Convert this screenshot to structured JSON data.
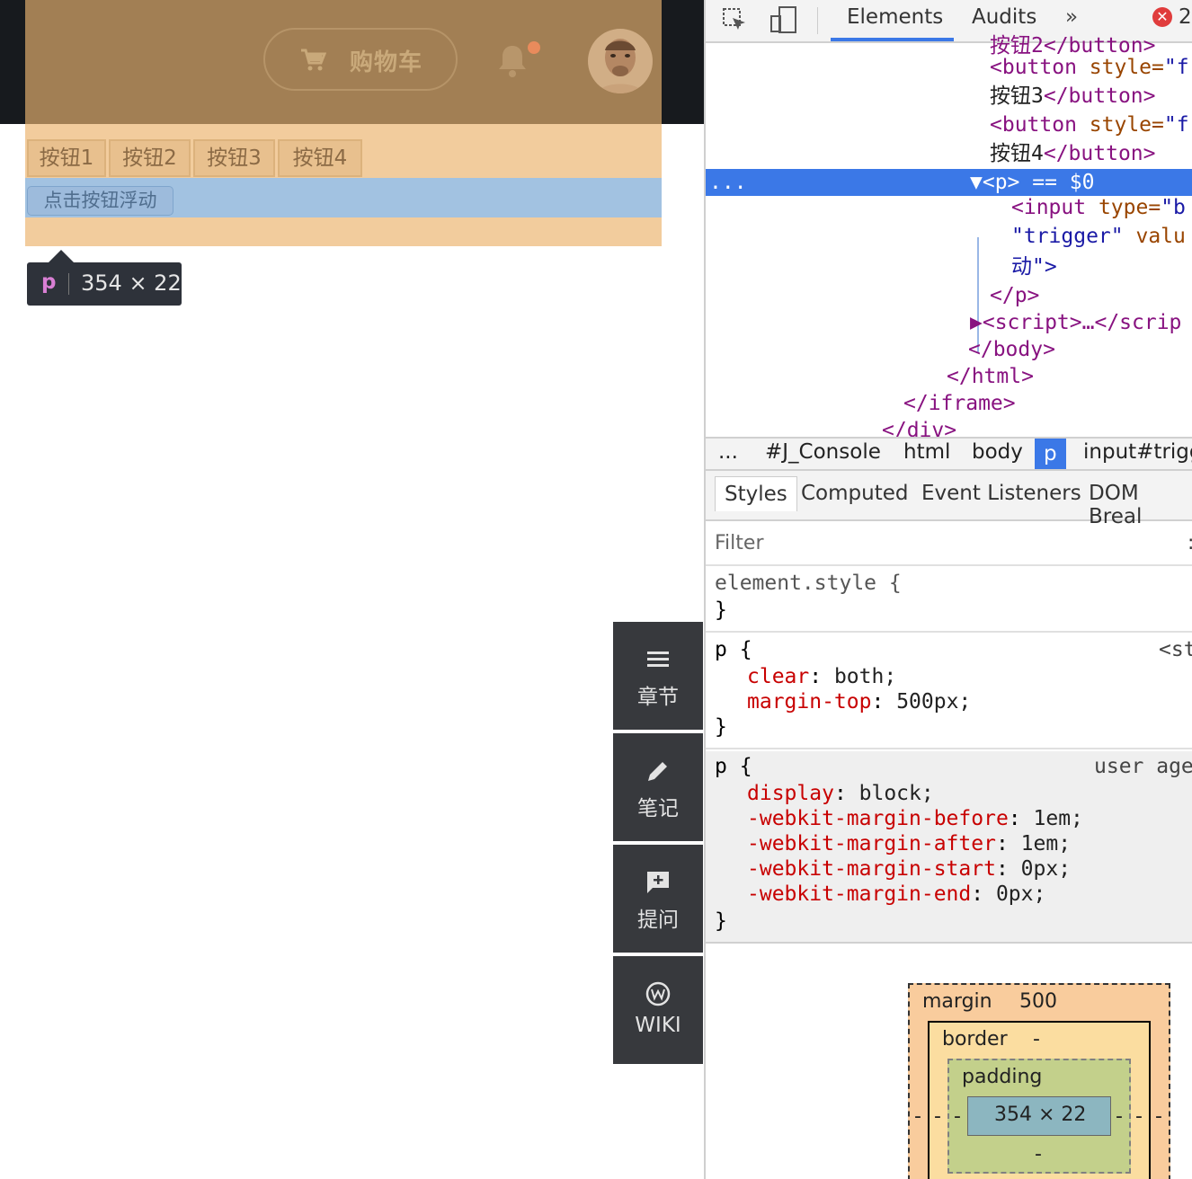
{
  "header": {
    "cart_label": "购物车",
    "cart_icon": "cart-icon",
    "bell_icon": "bell-icon",
    "colors": {
      "topbar": "#171a1e",
      "header_highlight": "#a27f54",
      "body_highlight": "#f2cc9d",
      "p_highlight": "#a2c2e1"
    }
  },
  "buttons": [
    "按钮1",
    "按钮2",
    "按钮3",
    "按钮4"
  ],
  "float_button_label": "点击按钮浮动",
  "tooltip": {
    "tag": "p",
    "dims": "354 × 22"
  },
  "sidebar": {
    "items": [
      {
        "label": "章节",
        "icon": "menu-icon"
      },
      {
        "label": "笔记",
        "icon": "pencil-icon"
      },
      {
        "label": "提问",
        "icon": "question-icon"
      },
      {
        "label": "WIKI",
        "icon": "wiki-icon"
      }
    ]
  },
  "devtools": {
    "tabs": {
      "elements": "Elements",
      "audits": "Audits",
      "more": "»"
    },
    "error_count": "2",
    "dom_lines": {
      "l0": "按钮2</button>",
      "l1a": "<button",
      "l1b": " style=",
      "l1c": "\"f",
      "l2a": "按钮3",
      "l2b": "</button>",
      "l3a": "<button",
      "l3b": " style=",
      "l3c": "\"f",
      "l4a": "按钮4",
      "l4b": "</button>",
      "sel_dots": "...",
      "sel": "▼<p> == $0",
      "l6a": "<input",
      "l6b": " type=",
      "l6c": "\"b",
      "l7a": "\"trigger\"",
      "l7b": " valu",
      "l8a": "动\">",
      "l9": "</p>",
      "l10": "▶<script>…</scrip",
      "l11": "</body>",
      "l12": "</html>",
      "l13": "</iframe>",
      "l14": "</div>"
    },
    "breadcrumb": [
      "...",
      "#J_Console",
      "html",
      "body",
      "p",
      "input#trigge"
    ],
    "subtabs": [
      "Styles",
      "Computed",
      "Event Listeners",
      "DOM Breal"
    ],
    "filter_placeholder": "Filter",
    "filter_right": ":",
    "rules": {
      "element_style": "element.style {",
      "close": "}",
      "p1_selector": "p {",
      "p1_source": "<st",
      "p1_props": [
        {
          "name": "clear",
          "value": "both;"
        },
        {
          "name": "margin-top",
          "value": "500px;"
        }
      ],
      "p2_selector": "p {",
      "p2_source": "user age",
      "p2_props": [
        {
          "name": "display",
          "value": "block;"
        },
        {
          "name": "-webkit-margin-before",
          "value": "1em;"
        },
        {
          "name": "-webkit-margin-after",
          "value": "1em;"
        },
        {
          "name": "-webkit-margin-start",
          "value": "0px;"
        },
        {
          "name": "-webkit-margin-end",
          "value": "0px;"
        }
      ]
    },
    "box_model": {
      "margin_label": "margin",
      "margin_value": "500",
      "border_label": "border",
      "border_value": "-",
      "padding_label": "padding",
      "content": "354 × 22",
      "dash": "-"
    }
  }
}
